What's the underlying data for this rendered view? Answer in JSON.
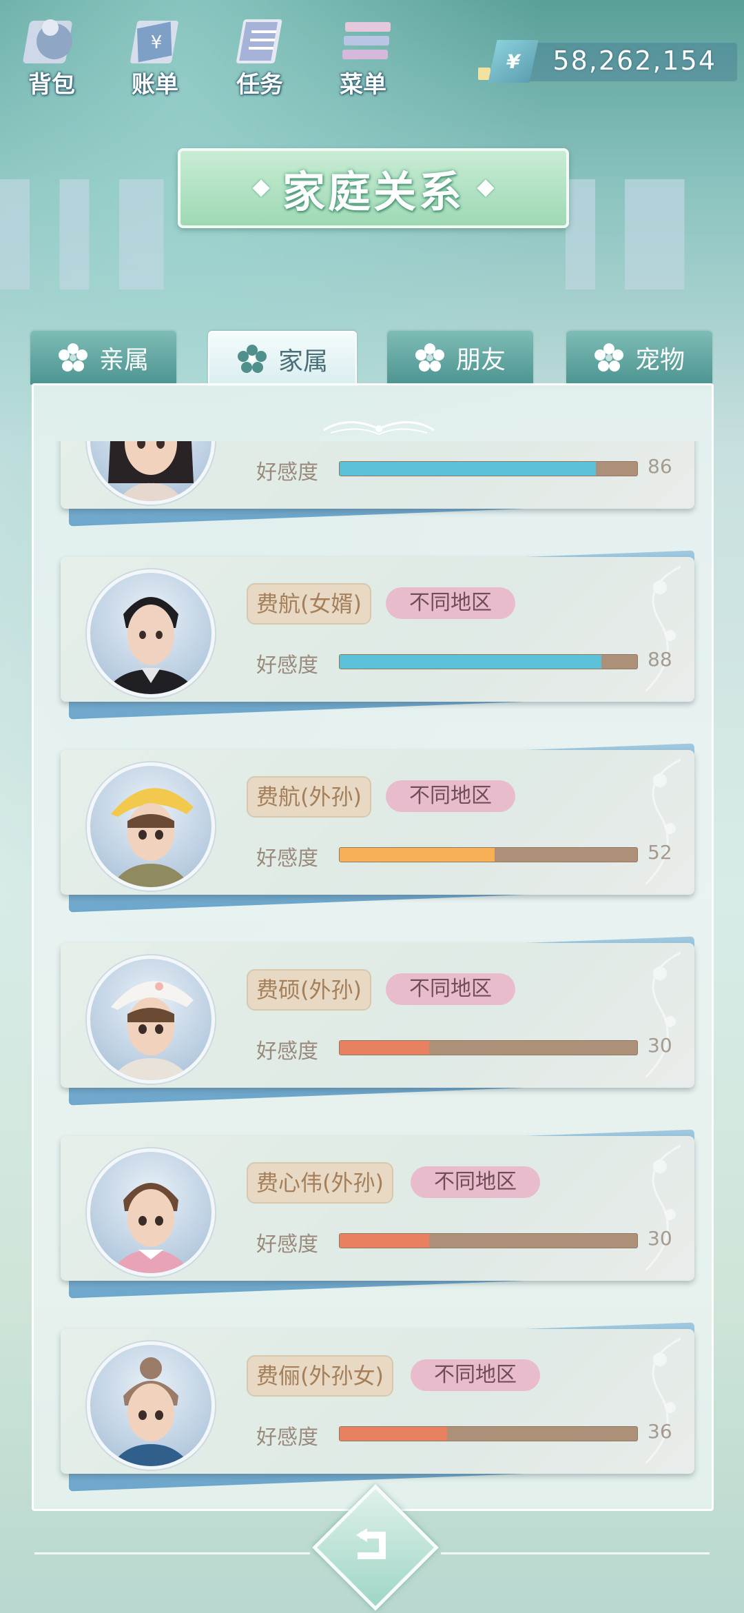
{
  "hud": {
    "bag_label": "背包",
    "bill_label": "账单",
    "task_label": "任务",
    "menu_label": "菜单",
    "currency_symbol": "¥",
    "money": "58,262,154"
  },
  "title": "家庭关系",
  "tabs": [
    {
      "label": "亲属",
      "active": false
    },
    {
      "label": "家属",
      "active": true
    },
    {
      "label": "朋友",
      "active": false
    },
    {
      "label": "宠物",
      "active": false
    }
  ],
  "affinity_label": "好感度",
  "cards": [
    {
      "name": "",
      "region": "",
      "affinity": 86,
      "affinity_text": "86",
      "bar_color": "#5cc0d9",
      "avatar": "girl-black-hair"
    },
    {
      "name": "费航(女婿)",
      "region": "不同地区",
      "affinity": 88,
      "affinity_text": "88",
      "bar_color": "#5cc0d9",
      "avatar": "man-black-suit"
    },
    {
      "name": "费航(外孙)",
      "region": "不同地区",
      "affinity": 52,
      "affinity_text": "52",
      "bar_color": "#f7b055",
      "avatar": "boy-yellow-hat"
    },
    {
      "name": "费硕(外孙)",
      "region": "不同地区",
      "affinity": 30,
      "affinity_text": "30",
      "bar_color": "#e9805f",
      "avatar": "boy-white-hat"
    },
    {
      "name": "费心伟(外孙)",
      "region": "不同地区",
      "affinity": 30,
      "affinity_text": "30",
      "bar_color": "#e9805f",
      "avatar": "boy-pink-collar"
    },
    {
      "name": "费俪(外孙女)",
      "region": "不同地区",
      "affinity": 36,
      "affinity_text": "36",
      "bar_color": "#e9805f",
      "avatar": "girl-hair-bun"
    }
  ],
  "icons": {
    "bag": "bag-icon",
    "bill": "bill-icon",
    "task": "task-icon",
    "menu": "menu-icon",
    "tab_flower": "flower-icon",
    "back": "back-arrow-icon"
  }
}
